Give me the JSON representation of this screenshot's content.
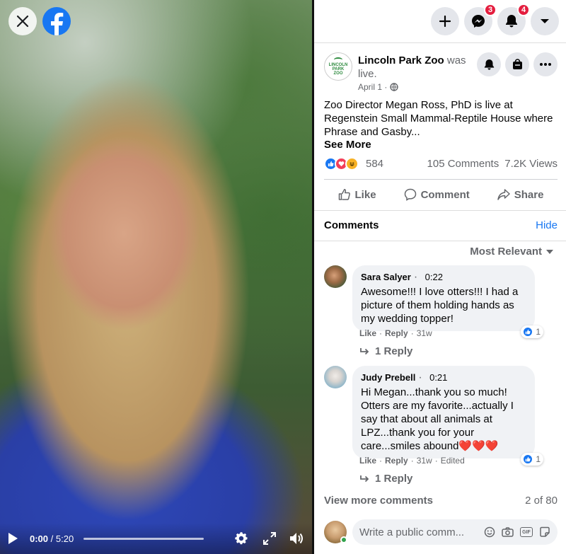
{
  "video": {
    "time_current": "0:00",
    "time_separator": "/",
    "time_total": "5:20",
    "progress": 0
  },
  "topbar": {
    "messenger_badge": "3",
    "notifications_badge": "4"
  },
  "post": {
    "page_name": "Lincoln Park Zoo",
    "page_logo_text": "LINCOLN PARK ZOO",
    "status": "was live.",
    "date": "April 1 ·",
    "text": "Zoo Director Megan Ross, PhD is live at Regenstein Small Mammal-Reptile House where Phrase and Gasby...",
    "see_more": "See More",
    "reaction_count": "584",
    "comment_count": "105 Comments",
    "view_count": "7.2K Views"
  },
  "actions": {
    "like": "Like",
    "comment": "Comment",
    "share": "Share"
  },
  "comments_section": {
    "title": "Comments",
    "hide": "Hide",
    "sort": "Most Relevant",
    "view_more": "View more comments",
    "count": "2 of 80"
  },
  "comments": [
    {
      "name": "Sara Salyer",
      "timestamp": "0:22",
      "text": "Awesome!!! I love otters!!! I had a picture of them holding hands as my wedding topper!",
      "like_count": "1",
      "like": "Like",
      "reply": "Reply",
      "age": "31w",
      "edited": "",
      "replies": "1 Reply"
    },
    {
      "name": "Judy Prebell",
      "timestamp": "0:21",
      "text": "Hi Megan...thank you so much! Otters are my favorite...actually I say that about all animals at LPZ...thank you for your care...smiles abound",
      "hearts": "❤️❤️❤️",
      "like_count": "1",
      "like": "Like",
      "reply": "Reply",
      "age": "31w",
      "edited": "Edited",
      "replies": "1 Reply"
    }
  ],
  "composer": {
    "placeholder": "Write a public comm...",
    "gif_label": "GIF"
  },
  "colors": {
    "facebook_blue": "#1877f2",
    "badge_red": "#e41e3f",
    "online_green": "#31a24c"
  }
}
